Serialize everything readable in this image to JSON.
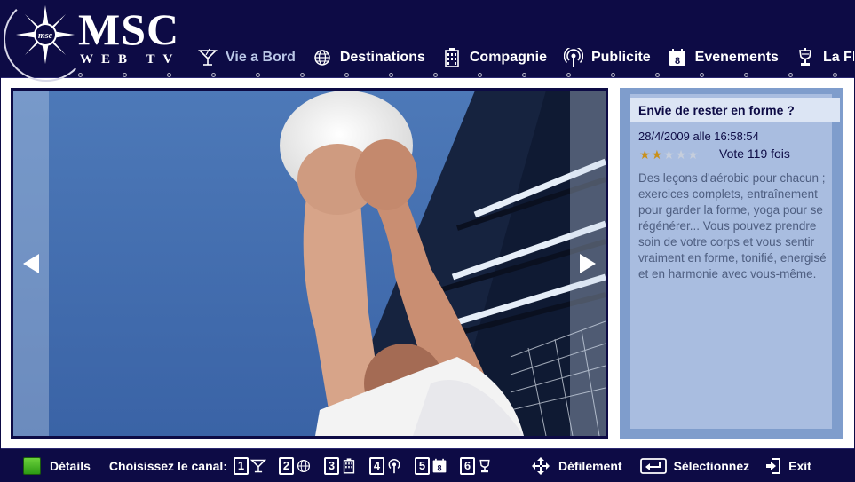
{
  "header": {
    "logo_text": "MSC",
    "logo_subtext": "WEB TV"
  },
  "nav": {
    "items": [
      {
        "label": "Vie a Bord",
        "icon": "cocktail-icon",
        "active": true
      },
      {
        "label": "Destinations",
        "icon": "globe-icon",
        "active": false
      },
      {
        "label": "Compagnie",
        "icon": "building-icon",
        "active": false
      },
      {
        "label": "Publicite",
        "icon": "broadcast-icon",
        "active": false
      },
      {
        "label": "Evenements",
        "icon": "calendar-icon",
        "active": false
      },
      {
        "label": "La Flotte",
        "icon": "trophy-icon",
        "active": false
      }
    ]
  },
  "video": {
    "prev_icon": "arrow-left-icon",
    "next_icon": "arrow-right-icon"
  },
  "info": {
    "title": "Envie de rester en forme ?",
    "date": "28/4/2009 alle 16:58:54",
    "rating": 2,
    "rating_max": 5,
    "votes": "Vote 119 fois",
    "description": "Des leçons d'aérobic pour chacun ; exercices complets, entraînement pour garder la forme, yoga pour se régénérer... Vous pouvez prendre soin de votre corps et vous sentir vraiment en forme, tonifié, energisé et en harmonie avec vous-même."
  },
  "footer": {
    "details_label": "Détails",
    "channel_label": "Choisissez le canal:",
    "channels": [
      {
        "num": "1",
        "icon": "cocktail-icon"
      },
      {
        "num": "2",
        "icon": "globe-icon"
      },
      {
        "num": "3",
        "icon": "building-icon"
      },
      {
        "num": "4",
        "icon": "broadcast-icon"
      },
      {
        "num": "5",
        "icon": "calendar-icon"
      },
      {
        "num": "6",
        "icon": "trophy-icon"
      }
    ],
    "scroll_label": "Défilement",
    "select_label": "Sélectionnez",
    "exit_label": "Exit"
  },
  "colors": {
    "navy": "#0d0b45",
    "panel_blue": "#7f9dcc",
    "panel_inner": "#a9bde0",
    "star_on": "#c9901a",
    "active_nav": "#b9c6e6",
    "green_button": "#4cb828"
  }
}
